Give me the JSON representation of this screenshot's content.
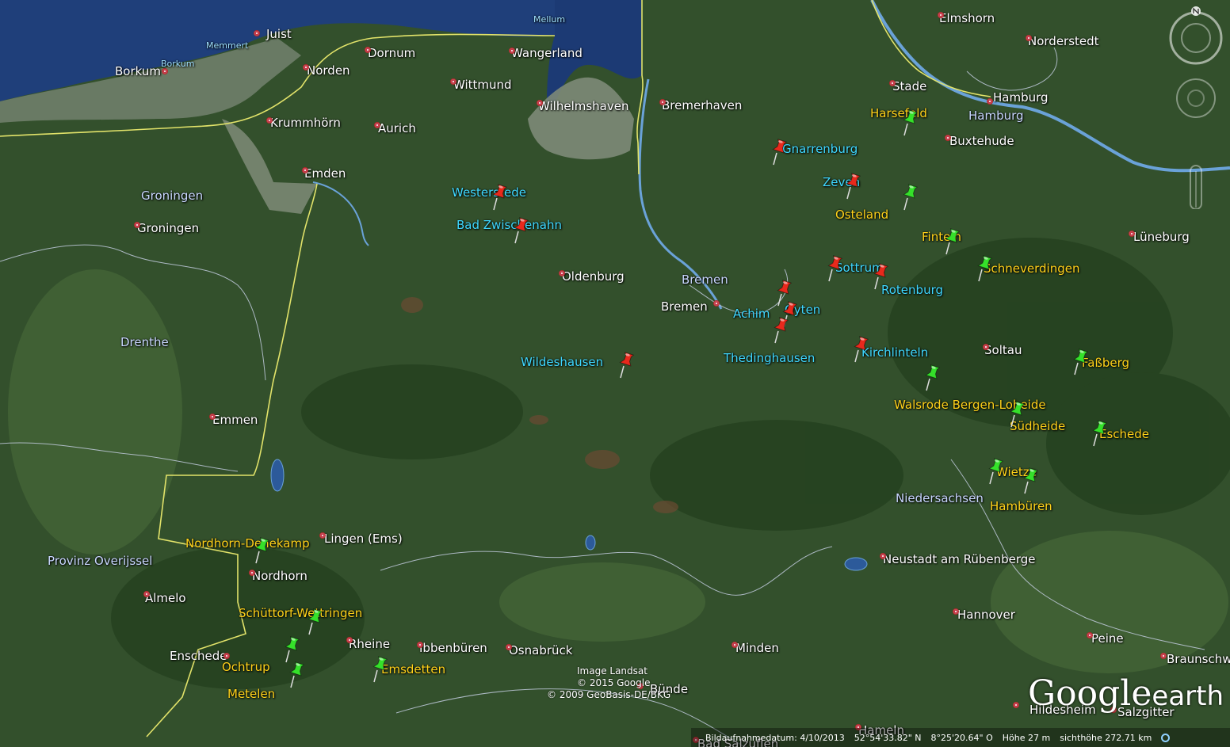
{
  "cities": [
    {
      "name": "Juist"
    },
    {
      "name": "Borkum"
    },
    {
      "name": "Norden"
    },
    {
      "name": "Dornum"
    },
    {
      "name": "Wangerland"
    },
    {
      "name": "Wittmund"
    },
    {
      "name": "Wilhelmshaven"
    },
    {
      "name": "Bremerhaven"
    },
    {
      "name": "Krummhörn"
    },
    {
      "name": "Aurich"
    },
    {
      "name": "Emden"
    },
    {
      "name": "Groningen"
    },
    {
      "name": "Oldenburg"
    },
    {
      "name": "Bremen"
    },
    {
      "name": "Elmshorn"
    },
    {
      "name": "Norderstedt"
    },
    {
      "name": "Stade"
    },
    {
      "name": "Hamburg"
    },
    {
      "name": "Buxtehude"
    },
    {
      "name": "Lüneburg"
    },
    {
      "name": "Soltau"
    },
    {
      "name": "Emmen"
    },
    {
      "name": "Lingen (Ems)"
    },
    {
      "name": "Nordhorn"
    },
    {
      "name": "Almelo"
    },
    {
      "name": "Enschede"
    },
    {
      "name": "Rheine"
    },
    {
      "name": "Ibbenbüren"
    },
    {
      "name": "Osnabrück"
    },
    {
      "name": "Minden"
    },
    {
      "name": "Bünde"
    },
    {
      "name": "Neustadt am Rübenberge"
    },
    {
      "name": "Hannover"
    },
    {
      "name": "Peine"
    },
    {
      "name": "Braunschw"
    },
    {
      "name": "Hildesheim"
    },
    {
      "name": "Salzgitter"
    },
    {
      "name": "Hameln"
    },
    {
      "name": "Bad Salzuflen"
    }
  ],
  "regions": [
    {
      "name": "Groningen"
    },
    {
      "name": "Drenthe"
    },
    {
      "name": "Provinz Overijssel"
    },
    {
      "name": "Niedersachsen"
    },
    {
      "name": "Bremen"
    },
    {
      "name": "Hamburg"
    }
  ],
  "water_labels": [
    {
      "name": "Memmert"
    },
    {
      "name": "Borkum"
    },
    {
      "name": "Mellum"
    }
  ],
  "red_markers": [
    {
      "name": "Westerstede"
    },
    {
      "name": "Bad Zwischenahn"
    },
    {
      "name": "Wildeshausen"
    },
    {
      "name": "Gnarrenburg"
    },
    {
      "name": "Zeven"
    },
    {
      "name": "Sottrum"
    },
    {
      "name": "Rotenburg"
    },
    {
      "name": "Achim"
    },
    {
      "name": "Oyten"
    },
    {
      "name": "Thedinghausen"
    },
    {
      "name": "Kirchlinteln"
    }
  ],
  "green_markers": [
    {
      "name": "Harsefeld"
    },
    {
      "name": "Osteland"
    },
    {
      "name": "Finteln"
    },
    {
      "name": "Schneverdingen"
    },
    {
      "name": "Faßberg"
    },
    {
      "name": "Walsrode Bergen-Loheide"
    },
    {
      "name": "Südheide"
    },
    {
      "name": "Eschede"
    },
    {
      "name": "Wietze"
    },
    {
      "name": "Hambüren"
    },
    {
      "name": "Nordhorn-Denekamp"
    },
    {
      "name": "Schüttorf-Wettringen"
    },
    {
      "name": "Ochtrup"
    },
    {
      "name": "Metelen"
    },
    {
      "name": "Emsdetten"
    }
  ],
  "credits": {
    "line1": "Image Landsat",
    "line2": "© 2015 Google",
    "line3": "© 2009 GeoBasis-DE/BKG"
  },
  "logo": {
    "google": "Google",
    "earth": "earth"
  },
  "status": {
    "date": "Bildaufnahmedatum: 4/10/2013",
    "lat": "52°54'33.82\" N",
    "lon": "8°25'20.64\" O",
    "elev": "Höhe   27 m",
    "eye": "sichthöhe 272.71 km"
  },
  "colors": {
    "land": "#33502c",
    "sea": "#1f3f7a",
    "mudflat": "#6f7e6a",
    "border_state": "#e2e36a",
    "border_district": "#c9d2e8",
    "river": "#6aa2d8",
    "red_pin": "#e8291c",
    "green_pin": "#35e02a",
    "red_label": "#3fd8ff",
    "green_label": "#ffd21a"
  }
}
